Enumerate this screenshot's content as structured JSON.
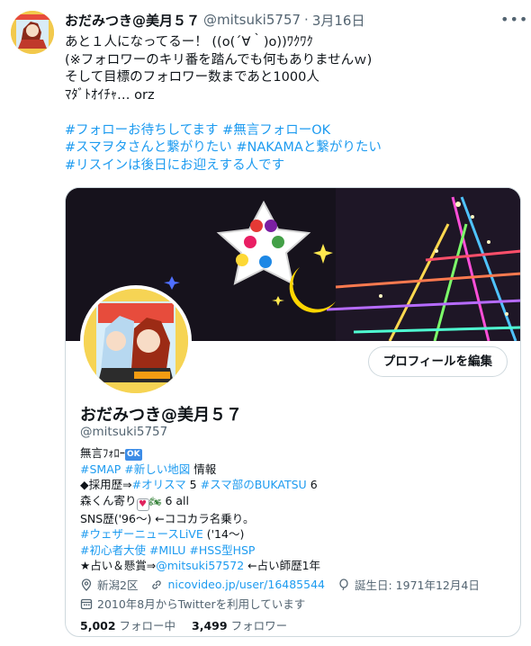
{
  "tweet": {
    "author_name": "おだみつき@美月５７",
    "handle": "@mitsuki5757",
    "separator": "·",
    "date": "3月16日",
    "more_icon": "more-dots-icon",
    "lines": [
      "あと１人になってるー！ ((o(´∀｀)o))ﾜｸﾜｸ",
      "(※フォロワーのキリ番を踏んでも何もありませんｗ)",
      "そして目標のフォロワー数まであと1000人",
      "ﾏﾀﾞﾄｵｲﾁｬ… orz"
    ],
    "hashtag_lines": [
      "#フォローお待ちしてます #無言フォローOK",
      "#スマヲタさんと繋がりたい #NAKAMAと繋がりたい",
      "#リスインは後日にお迎えする人です"
    ]
  },
  "card": {
    "profile_name": "おだみつき@美月５７",
    "profile_handle": "@mitsuki5757",
    "edit_button": "プロフィールを編集",
    "bio": {
      "line1_text": "無言ﾌｫﾛｰ",
      "line1_badge": "OK",
      "line2_tags": "#SMAP #新しい地図",
      "line2_text": " 情報",
      "line3_prefix": "◆採用歴⇒",
      "line3_tag1": "#オリスマ",
      "line3_mid": " 5 ",
      "line3_tag2": "#スマ部のBUKATSU",
      "line3_suffix": " 6",
      "line4_prefix": "森くん寄り",
      "line4_suffix": " 6 all",
      "line5": "SNS歴('96〜) ←ココカラ名乗り。",
      "line6_tag": "#ウェザーニュースLiVE",
      "line6_text": " ('14〜)",
      "line7_tags": "#初心者大使 #MILU #HSS型HSP",
      "line8_prefix": "★占い＆懸賞⇒",
      "line8_link": "@mitsuki57572",
      "line8_suffix": " ←占い師歴1年"
    },
    "meta": {
      "location": "新潟2区",
      "link": "nicovideo.jp/user/16485544",
      "birthday": "誕生日: 1971年12月4日",
      "joined": "2010年8月からTwitterを利用しています"
    },
    "following_count": "5,002",
    "following_label": "フォロー中",
    "followers_count": "3,499",
    "followers_label": "フォロワー"
  },
  "colors": {
    "link": "#1d9bf0",
    "text": "#0f1419",
    "muted": "#536471",
    "border": "#cfd9de"
  }
}
